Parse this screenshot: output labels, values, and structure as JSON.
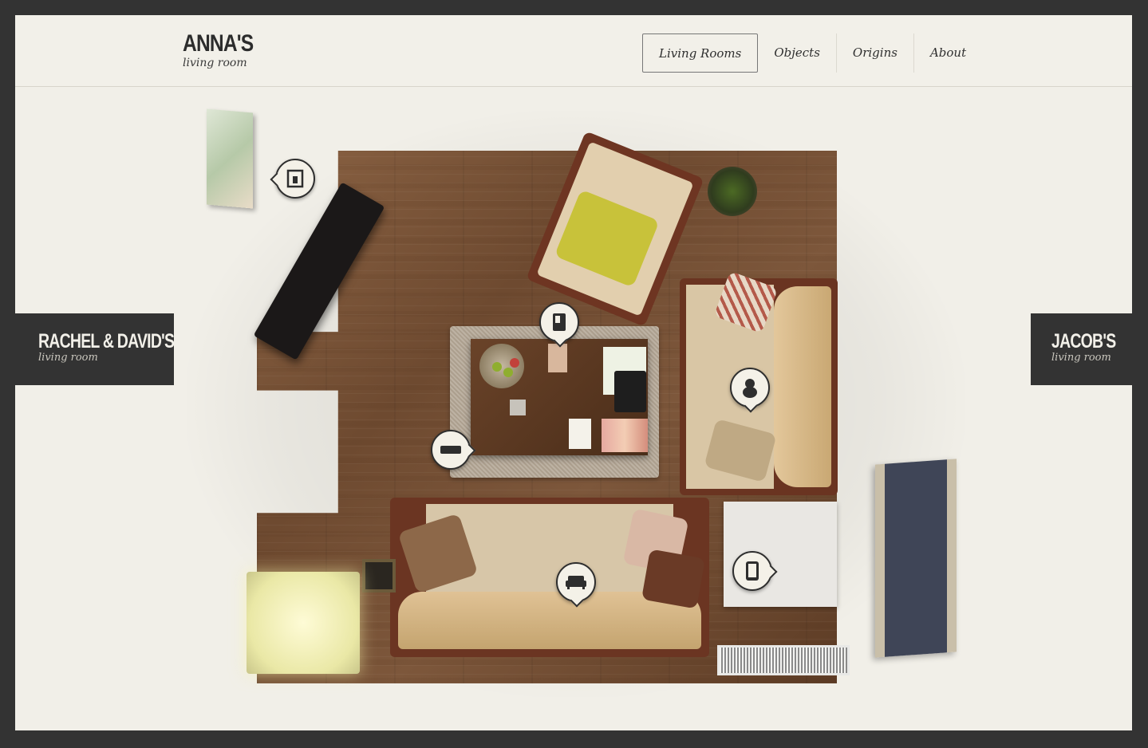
{
  "logo": {
    "title": "ANNA'S",
    "subtitle": "living room"
  },
  "nav": {
    "items": [
      {
        "label": "Living Rooms",
        "active": true
      },
      {
        "label": "Objects",
        "active": false
      },
      {
        "label": "Origins",
        "active": false
      },
      {
        "label": "About",
        "active": false
      }
    ]
  },
  "prev_room": {
    "title": "RACHEL & DAVID'S",
    "subtitle": "living room"
  },
  "next_room": {
    "title": "JACOB'S",
    "subtitle": "living room"
  },
  "hotspots": [
    {
      "icon": "picture-frame-icon"
    },
    {
      "icon": "book-icon"
    },
    {
      "icon": "figurine-icon"
    },
    {
      "icon": "remote-control-icon"
    },
    {
      "icon": "sofa-icon"
    },
    {
      "icon": "tablet-icon"
    }
  ],
  "colors": {
    "background": "#333333",
    "page": "#f1efe8",
    "accent": "#2c2c2c"
  }
}
